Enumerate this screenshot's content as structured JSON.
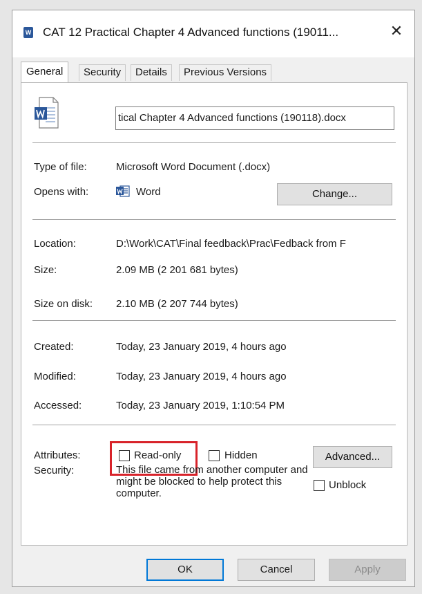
{
  "window": {
    "title": "CAT 12 Practical Chapter 4  Advanced functions (19011...",
    "close_glyph": "✕",
    "icon_letter": "W"
  },
  "tabs": [
    {
      "label": "General",
      "active": true
    },
    {
      "label": "Security",
      "active": false
    },
    {
      "label": "Details",
      "active": false
    },
    {
      "label": "Previous Versions",
      "active": false
    }
  ],
  "file": {
    "name_value": "tical Chapter 4  Advanced functions (190118).docx",
    "icon": "word-document-icon"
  },
  "type": {
    "type_label": "Type of file:",
    "type_value": "Microsoft Word Document (.docx)",
    "opens_label": "Opens with:",
    "opens_value": "Word",
    "change_label": "Change..."
  },
  "location": {
    "location_label": "Location:",
    "location_value": "D:\\Work\\CAT\\Final feedback\\Prac\\Fedback from F",
    "size_label": "Size:",
    "size_value": "2.09 MB (2 201 681 bytes)",
    "disk_label": "Size on disk:",
    "disk_value": "2.10 MB (2 207 744 bytes)"
  },
  "dates": {
    "created_label": "Created:",
    "created_value": "Today, 23 January 2019, 4 hours ago",
    "modified_label": "Modified:",
    "modified_value": "Today, 23 January 2019, 4 hours ago",
    "accessed_label": "Accessed:",
    "accessed_value": "Today, 23 January 2019, 1:10:54 PM"
  },
  "attributes": {
    "label": "Attributes:",
    "readonly_label": "Read-only",
    "readonly_checked": false,
    "hidden_label": "Hidden",
    "hidden_checked": false,
    "advanced_label": "Advanced...",
    "highlight_color": "#d8232a"
  },
  "security": {
    "label": "Security:",
    "text": "This file came from another computer and might be blocked to help protect this computer.",
    "unblock_label": "Unblock",
    "unblock_checked": false
  },
  "footer": {
    "ok_label": "OK",
    "cancel_label": "Cancel",
    "apply_label": "Apply"
  },
  "colors": {
    "accent": "#0078d7",
    "word_blue": "#2b579a"
  }
}
